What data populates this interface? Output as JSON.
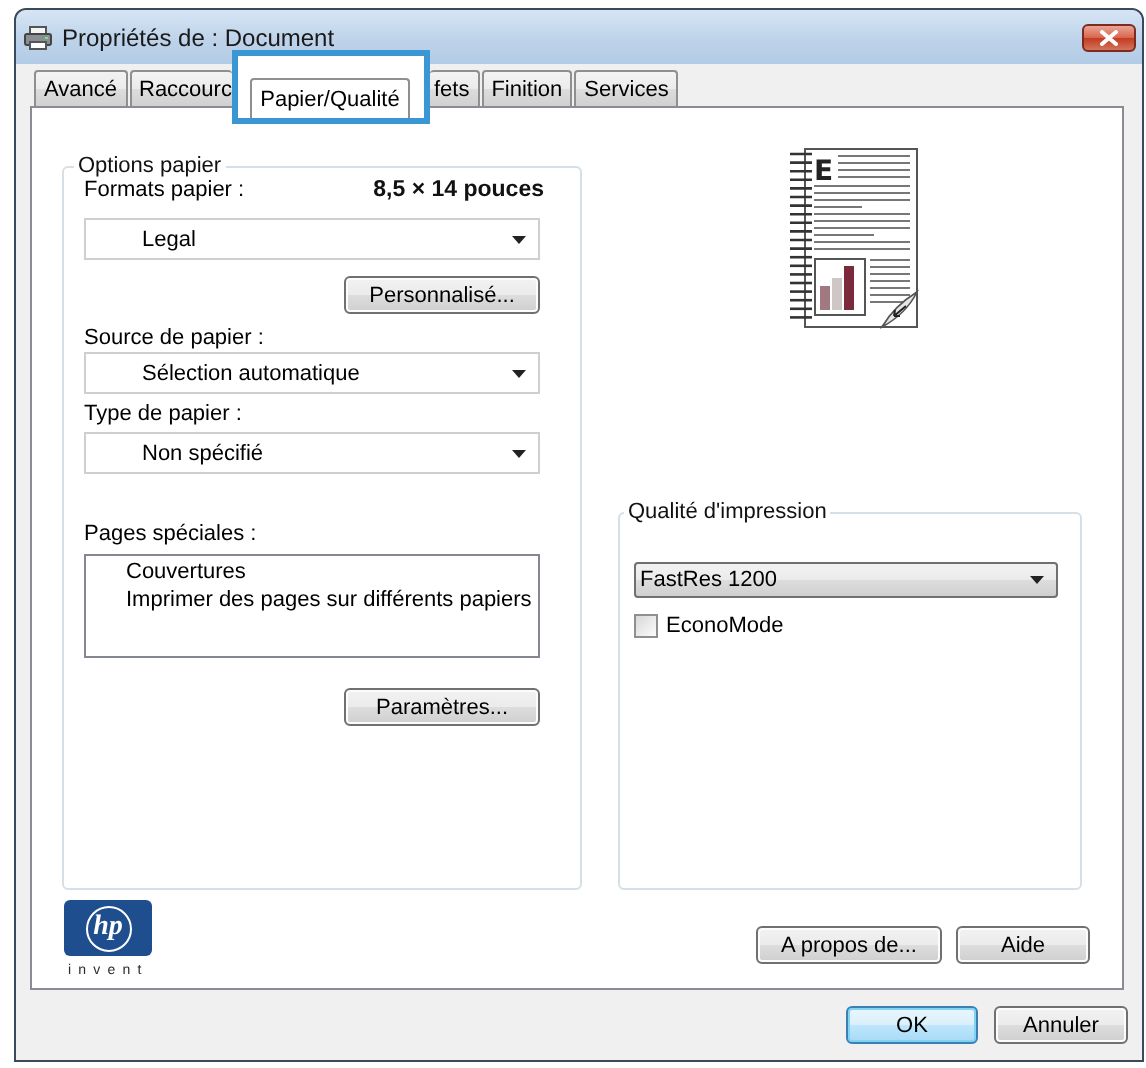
{
  "window": {
    "title": "Propriétés de : Document"
  },
  "tabs": [
    {
      "label": "Avancé",
      "selected": false,
      "highlighted": false
    },
    {
      "label": "Raccourc",
      "selected": false,
      "highlighted": false
    },
    {
      "label": "Papier/Qualité",
      "selected": true,
      "highlighted": true
    },
    {
      "label": "fets",
      "selected": false,
      "highlighted": false
    },
    {
      "label": "Finition",
      "selected": false,
      "highlighted": false
    },
    {
      "label": "Services",
      "selected": false,
      "highlighted": false
    }
  ],
  "paper_options": {
    "title": "Options papier",
    "size_label": "Formats papier :",
    "size_dimensions": "8,5 × 14 pouces",
    "size": "Legal",
    "custom_button": "Personnalisé...",
    "source_label": "Source de papier :",
    "source": "Sélection automatique",
    "type_label": "Type de papier :",
    "type": "Non spécifié",
    "special_pages_label": "Pages spéciales :",
    "special_pages": [
      {
        "label": "Couvertures",
        "selected": false
      },
      {
        "label": "Imprimer des pages sur différents papiers",
        "selected": false
      }
    ],
    "settings_button": "Paramètres..."
  },
  "preview": {
    "drop_cap": "E"
  },
  "print_quality": {
    "title": "Qualité d'impression",
    "quality": "FastRes 1200",
    "econo_mode": {
      "label": "EconoMode",
      "checked": false
    }
  },
  "logo": {
    "mark": "hp",
    "tagline": "invent"
  },
  "panel_buttons": [
    "A propos de...",
    "Aide"
  ],
  "dialog_buttons": [
    {
      "label": "OK",
      "default": true
    },
    {
      "label": "Annuler",
      "default": false
    }
  ]
}
